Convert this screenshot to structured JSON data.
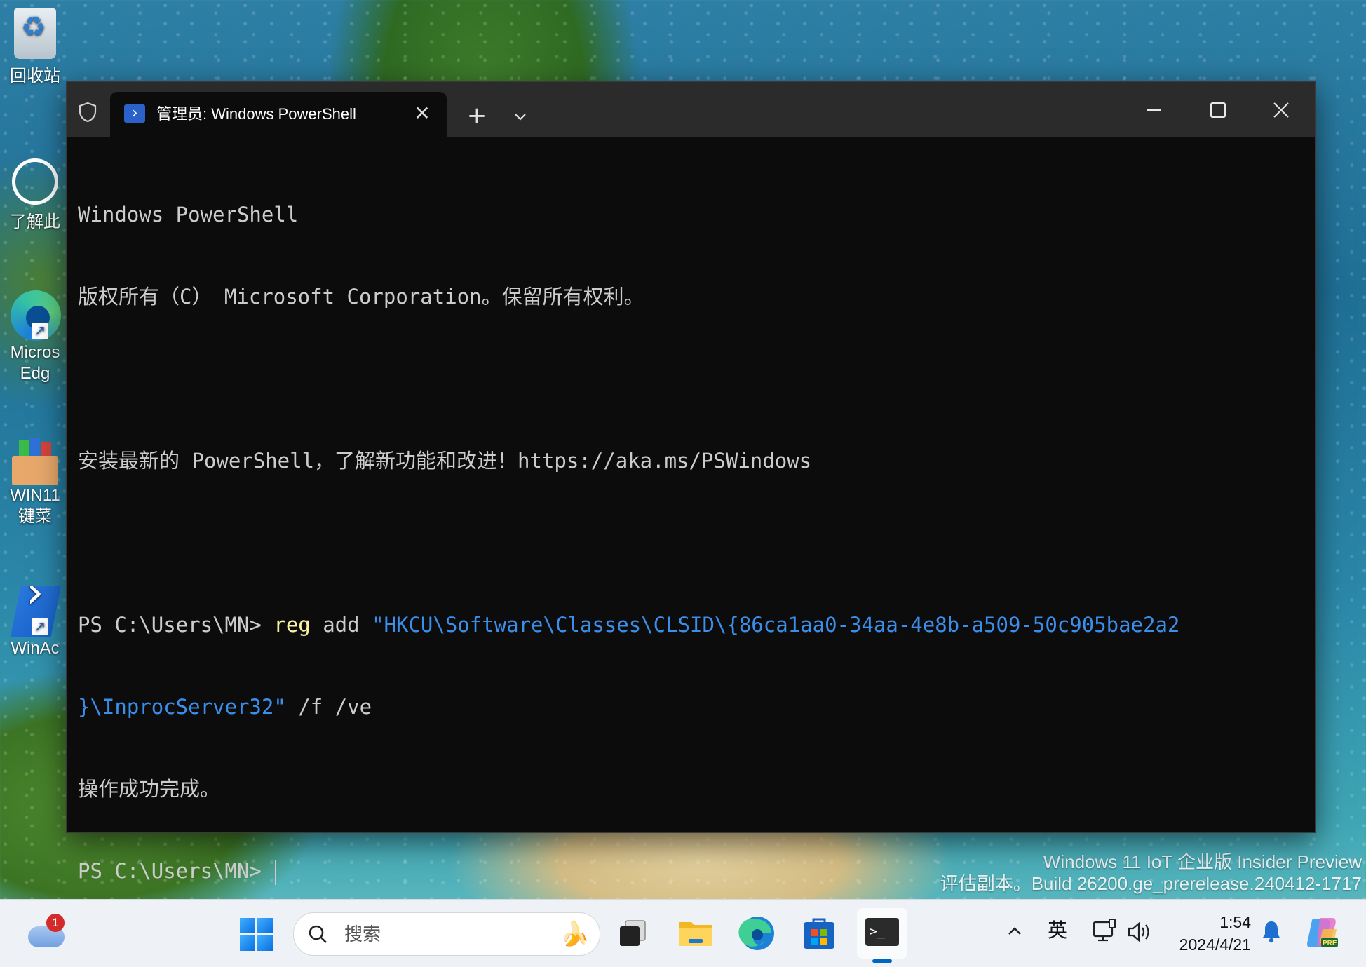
{
  "desktop": {
    "icons": [
      {
        "label": "回收站"
      },
      {
        "label": "了解此"
      },
      {
        "label_line1": "Micros",
        "label_line2": "Edg"
      },
      {
        "label_line1": "WIN11",
        "label_line2": "键菜"
      },
      {
        "label": "WinAc"
      }
    ],
    "watermark": {
      "line1": "Windows 11 IoT 企业版 Insider Preview",
      "line2": "评估副本。Build 26200.ge_prerelease.240412-1717"
    }
  },
  "window": {
    "tab_title": "管理员: Windows PowerShell",
    "new_tab_label": "+",
    "tab_close_label": "✕"
  },
  "console": {
    "line1": "Windows PowerShell",
    "line2": "版权所有（C） Microsoft Corporation。保留所有权利。",
    "line3": "安装最新的 PowerShell，了解新功能和改进！https://aka.ms/PSWindows",
    "cmd_prompt": "PS C:\\Users\\MN> ",
    "cmd_keyword": "reg",
    "cmd_args": " add ",
    "cmd_string_part1": "\"HKCU\\Software\\Classes\\CLSID\\{86ca1aa0-34aa-4e8b-a509-50c905bae2a2",
    "cmd_string_part2": "}\\InprocServer32\"",
    "cmd_flags": " /f /ve",
    "result": "操作成功完成。",
    "prompt2": "PS C:\\Users\\MN> "
  },
  "taskbar": {
    "weather_badge": "1",
    "search_placeholder": "搜索",
    "ime_label": "英",
    "time": "1:54",
    "date": "2024/4/21"
  },
  "colors": {
    "console_bg": "#0c0c0c",
    "console_text": "#cccccc",
    "keyword": "#f9f1a5",
    "string": "#3b8eea",
    "titlebar": "#2b2b2b"
  }
}
